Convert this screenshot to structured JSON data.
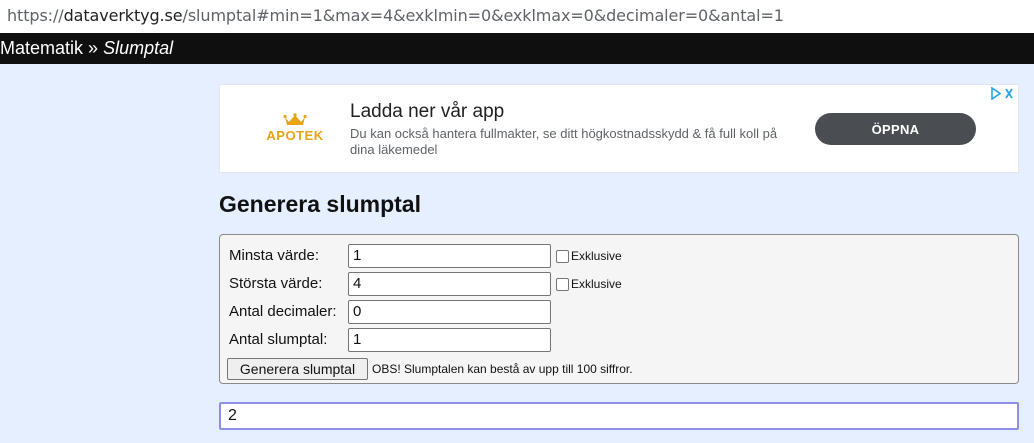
{
  "browser": {
    "url_prefix": "https://",
    "url_domain": "dataverktyg.se",
    "url_path": "/slumptal#min=1&max=4&exklmin=0&exklmax=0&decimaler=0&antal=1"
  },
  "breadcrumb": {
    "parent": "Matematik",
    "separator": "»",
    "current": "Slumptal"
  },
  "ad": {
    "brand": "APOTEK",
    "title": "Ladda ner vår app",
    "description": "Du kan också hantera fullmakter, se ditt högkostnadsskydd & få full koll på dina läkemedel",
    "cta": "ÖPPNA",
    "brand_color": "#e8a317",
    "choices_icon": "adchoices-icon"
  },
  "page": {
    "title": "Generera slumptal"
  },
  "form": {
    "min_label": "Minsta värde:",
    "min_value": "1",
    "min_exclusive_label": "Exklusive",
    "min_exclusive_checked": false,
    "max_label": "Största värde:",
    "max_value": "4",
    "max_exclusive_label": "Exklusive",
    "max_exclusive_checked": false,
    "decimals_label": "Antal decimaler:",
    "decimals_value": "0",
    "count_label": "Antal slumptal:",
    "count_value": "1",
    "generate_button": "Generera slumptal",
    "note": "OBS! Slumptalen kan bestå av upp till 100 siffror."
  },
  "result": {
    "value": "2"
  },
  "colors": {
    "page_bg": "#e5efff",
    "navbar_bg": "#0f0f0f",
    "result_border": "#8f8fe6"
  }
}
